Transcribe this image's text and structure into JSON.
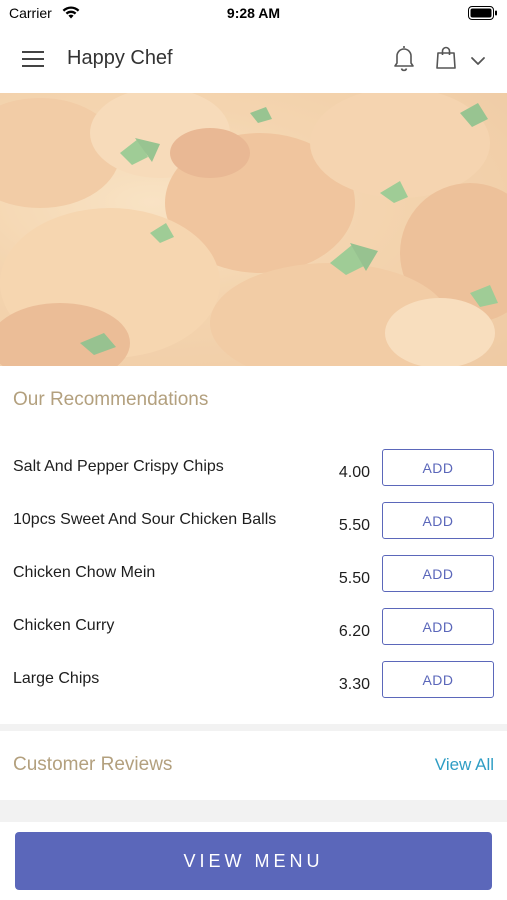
{
  "status_bar": {
    "carrier": "Carrier",
    "time": "9:28 AM"
  },
  "nav": {
    "title": "Happy Chef"
  },
  "recommendations": {
    "title": "Our Recommendations",
    "items": [
      {
        "name": "Salt And Pepper Crispy Chips",
        "price": "4.00",
        "add_label": "ADD"
      },
      {
        "name": "10pcs Sweet And Sour Chicken Balls",
        "price": "5.50",
        "add_label": "ADD"
      },
      {
        "name": "Chicken Chow Mein",
        "price": "5.50",
        "add_label": "ADD"
      },
      {
        "name": "Chicken Curry",
        "price": "6.20",
        "add_label": "ADD"
      },
      {
        "name": "Large Chips",
        "price": "3.30",
        "add_label": "ADD"
      }
    ]
  },
  "reviews": {
    "title": "Customer Reviews",
    "view_all": "View All"
  },
  "footer": {
    "view_menu": "VIEW MENU"
  },
  "colors": {
    "accent": "#5b67ba",
    "section_title": "#b3a07e",
    "link": "#2f9dc4"
  },
  "icons": [
    "wifi-icon",
    "battery-icon",
    "hamburger-icon",
    "bell-icon",
    "shopping-bag-icon",
    "chevron-down-icon"
  ]
}
